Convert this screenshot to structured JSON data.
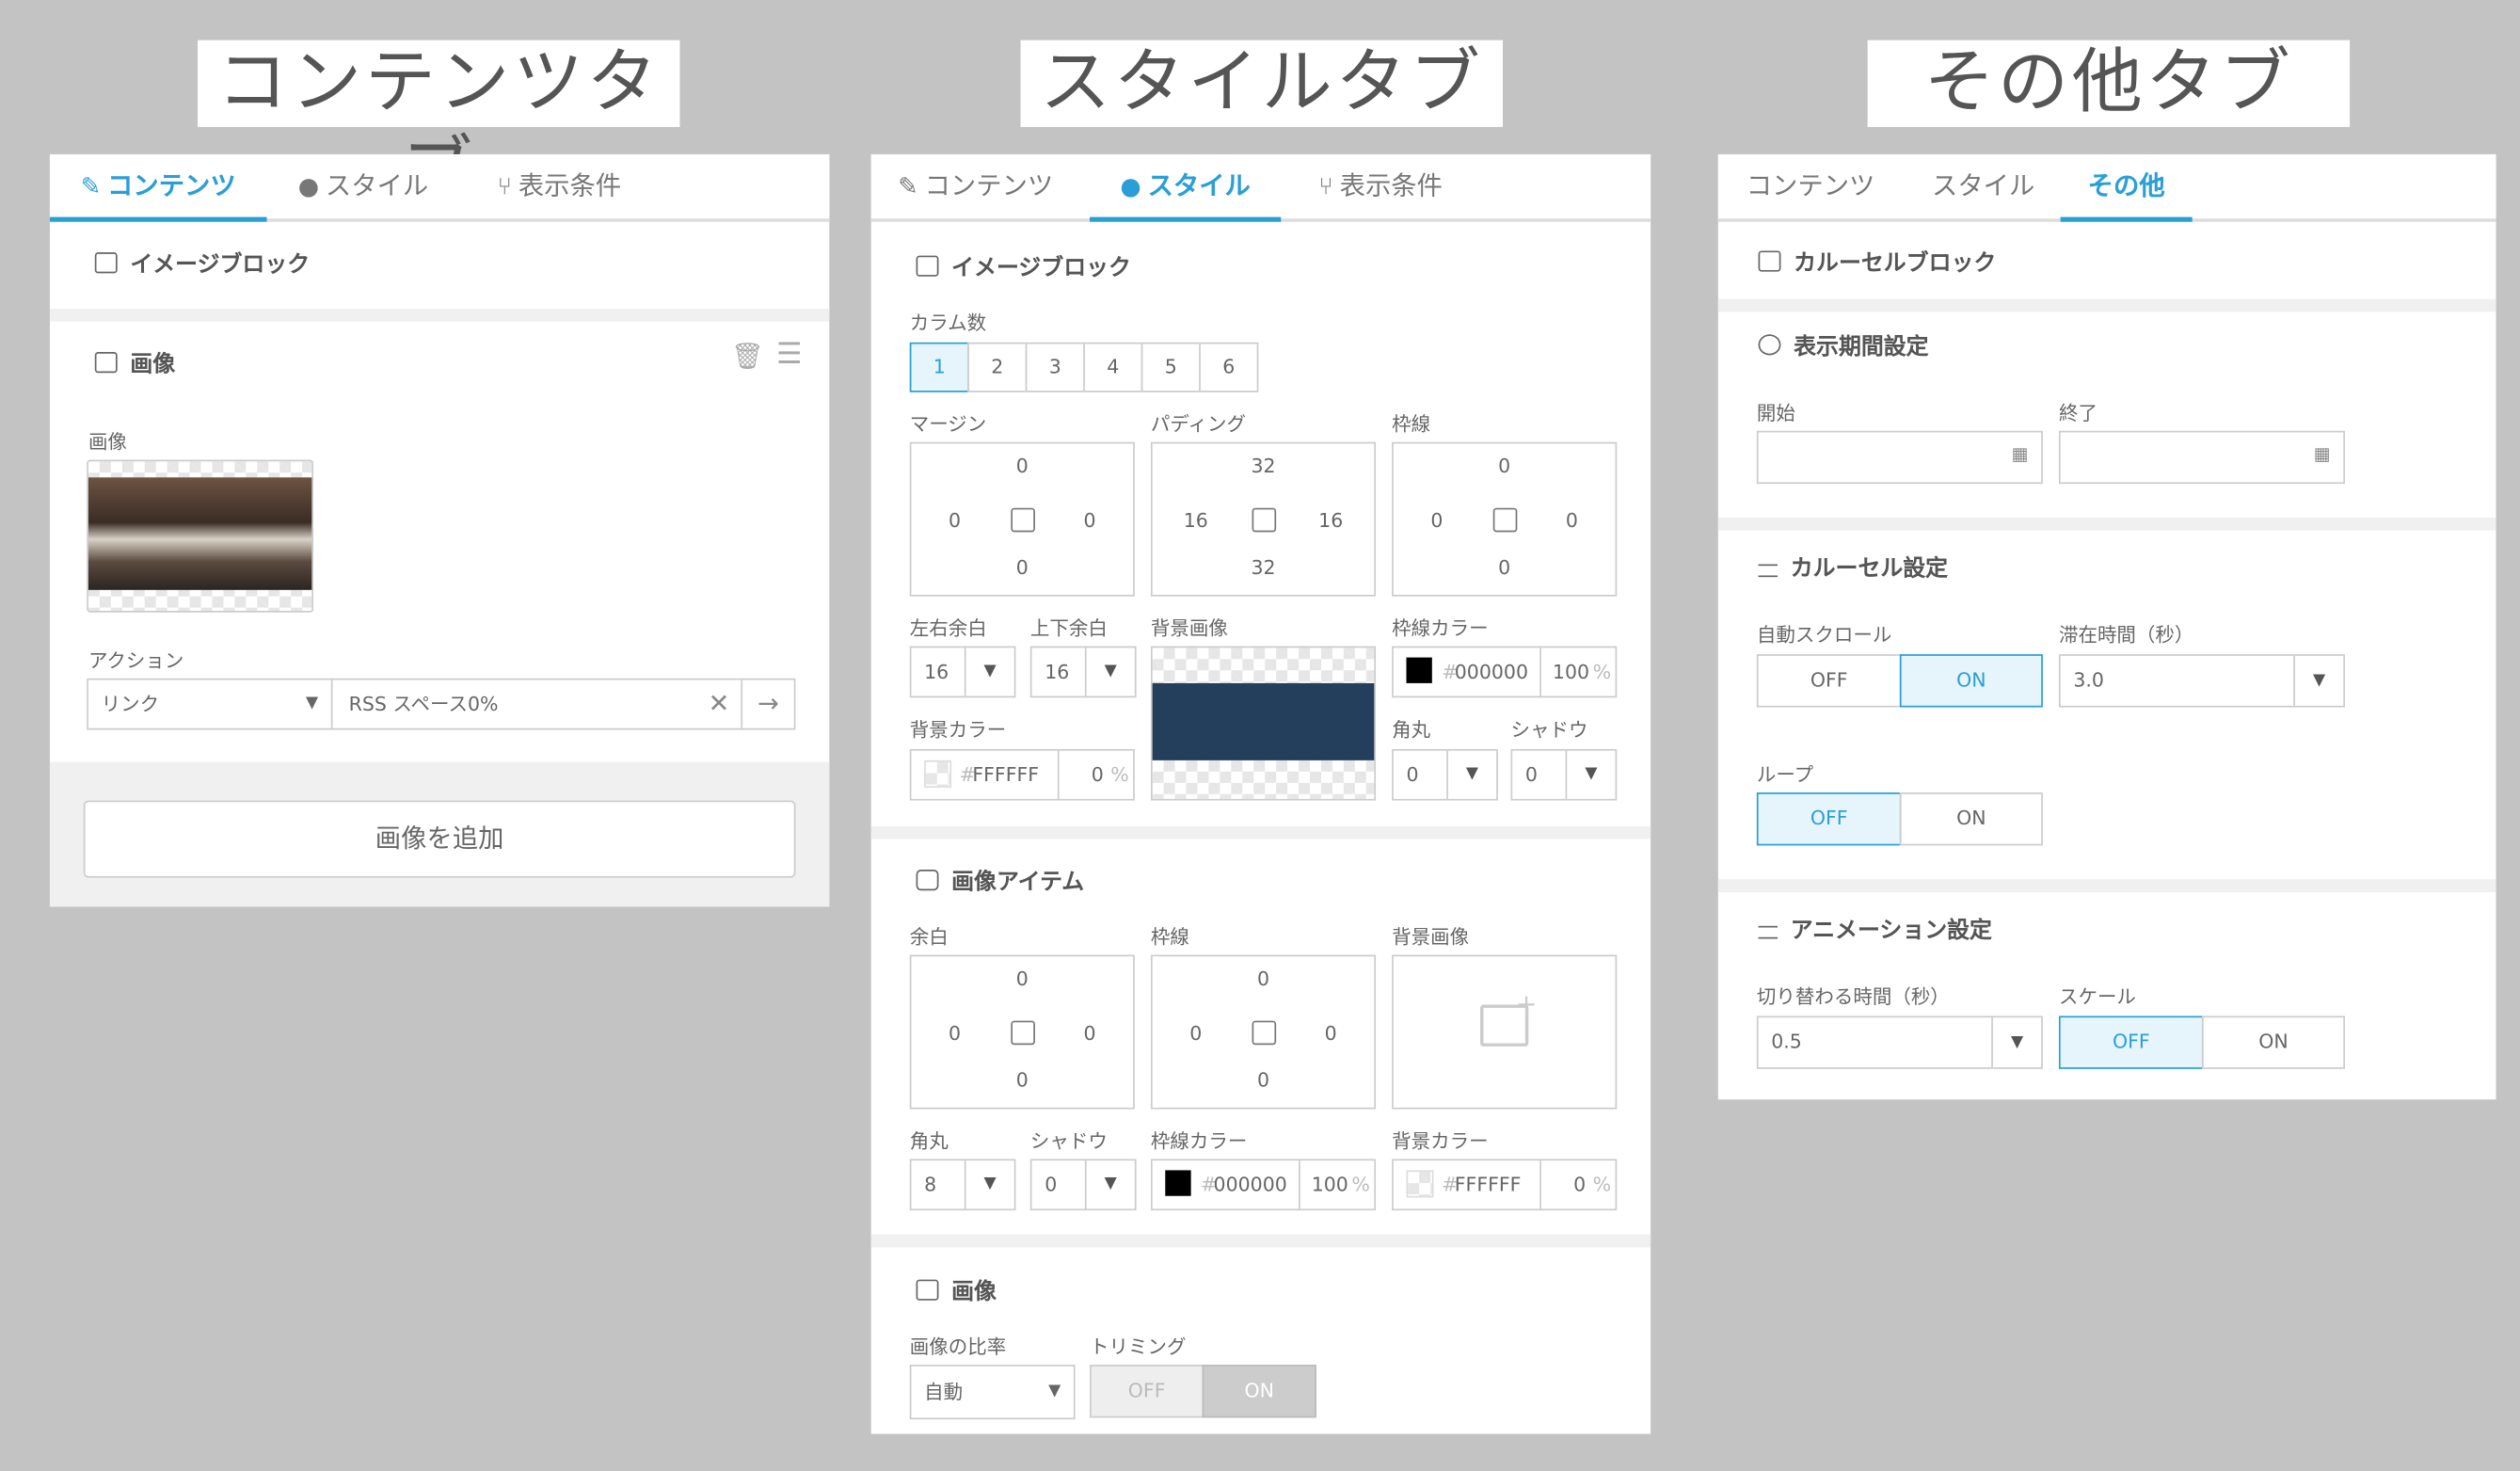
{
  "titles": {
    "content": "コンテンツタブ",
    "style": "スタイルタブ",
    "other": "その他タブ"
  },
  "content_panel": {
    "tabs": [
      "コンテンツ",
      "スタイル",
      "表示条件"
    ],
    "block_title": "イメージブロック",
    "image_section": "画像",
    "image_label": "画像",
    "action_label": "アクション",
    "action_type": "リンク",
    "action_value": "RSS スペース0%",
    "add_image_button": "画像を追加"
  },
  "style_panel": {
    "tabs": [
      "コンテンツ",
      "スタイル",
      "表示条件"
    ],
    "block_title": "イメージブロック",
    "columns_label": "カラム数",
    "columns": [
      "1",
      "2",
      "3",
      "4",
      "5",
      "6"
    ],
    "margin_label": "マージン",
    "margin": {
      "top": "0",
      "left": "0",
      "right": "0",
      "bottom": "0"
    },
    "padding_label": "パディング",
    "padding": {
      "top": "32",
      "left": "16",
      "right": "16",
      "bottom": "32"
    },
    "border_label": "枠線",
    "border": {
      "top": "0",
      "left": "0",
      "right": "0",
      "bottom": "0"
    },
    "lr_margin_label": "左右余白",
    "lr_margin": "16",
    "tb_margin_label": "上下余白",
    "tb_margin": "16",
    "bg_image_label": "背景画像",
    "border_color_label": "枠線カラー",
    "border_color": "000000",
    "border_color_opacity": "100",
    "bg_color_label": "背景カラー",
    "bg_color": "FFFFFF",
    "bg_color_opacity": "0",
    "radius_label": "角丸",
    "radius": "0",
    "shadow_label": "シャドウ",
    "shadow": "0",
    "item_title": "画像アイテム",
    "item_spacing_label": "余白",
    "item_spacing": {
      "top": "0",
      "left": "0",
      "right": "0",
      "bottom": "0"
    },
    "item_border_label": "枠線",
    "item_border": {
      "top": "0",
      "left": "0",
      "right": "0",
      "bottom": "0"
    },
    "item_bg_image_label": "背景画像",
    "item_radius_label": "角丸",
    "item_radius": "8",
    "item_shadow_label": "シャドウ",
    "item_shadow": "0",
    "item_border_color_label": "枠線カラー",
    "item_border_color": "000000",
    "item_border_opacity": "100",
    "item_bg_color_label": "背景カラー",
    "item_bg_color": "FFFFFF",
    "item_bg_opacity": "0",
    "image_title": "画像",
    "ratio_label": "画像の比率",
    "ratio": "自動",
    "trim_label": "トリミング",
    "trim_off": "OFF",
    "trim_on": "ON",
    "hash": "#",
    "percent": "%"
  },
  "other_panel": {
    "tabs": [
      "コンテンツ",
      "スタイル",
      "その他"
    ],
    "block_title": "カルーセルブロック",
    "period_title": "表示期間設定",
    "start_label": "開始",
    "end_label": "終了",
    "carousel_title": "カルーセル設定",
    "autoscroll_label": "自動スクロール",
    "autoscroll_off": "OFF",
    "autoscroll_on": "ON",
    "stay_label": "滞在時間（秒）",
    "stay_value": "3.0",
    "loop_label": "ループ",
    "loop_off": "OFF",
    "loop_on": "ON",
    "anim_title": "アニメーション設定",
    "switch_label": "切り替わる時間（秒）",
    "switch_value": "0.5",
    "scale_label": "スケール",
    "scale_off": "OFF",
    "scale_on": "ON"
  },
  "colors": {
    "accent": "#2a9fd6",
    "bg_image_fill": "#243f5c",
    "background": "#c3c3c3"
  }
}
